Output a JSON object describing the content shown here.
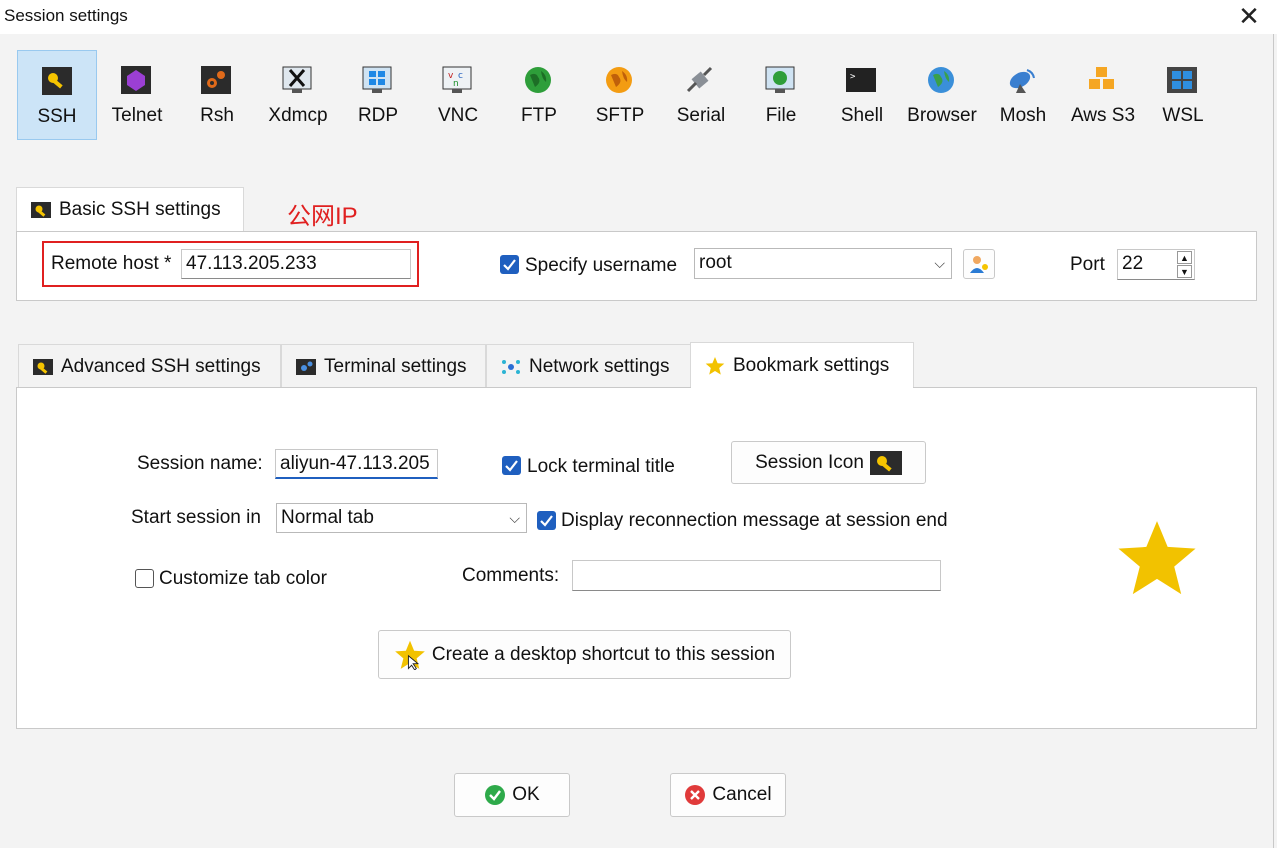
{
  "window": {
    "title": "Session settings"
  },
  "protocols": [
    {
      "label": "SSH",
      "icon": "ssh-key-icon",
      "selected": true
    },
    {
      "label": "Telnet",
      "icon": "telnet-icon"
    },
    {
      "label": "Rsh",
      "icon": "rsh-gear-icon"
    },
    {
      "label": "Xdmcp",
      "icon": "xdmcp-x-icon"
    },
    {
      "label": "RDP",
      "icon": "rdp-windows-icon"
    },
    {
      "label": "VNC",
      "icon": "vnc-icon"
    },
    {
      "label": "FTP",
      "icon": "ftp-globe-icon"
    },
    {
      "label": "SFTP",
      "icon": "sftp-globe-icon"
    },
    {
      "label": "Serial",
      "icon": "serial-plug-icon"
    },
    {
      "label": "File",
      "icon": "file-monitor-icon"
    },
    {
      "label": "Shell",
      "icon": "shell-terminal-icon"
    },
    {
      "label": "Browser",
      "icon": "browser-globe-icon"
    },
    {
      "label": "Mosh",
      "icon": "mosh-satellite-icon"
    },
    {
      "label": "Aws S3",
      "icon": "aws-cubes-icon"
    },
    {
      "label": "WSL",
      "icon": "wsl-windows-icon"
    }
  ],
  "basic": {
    "tab_label": "Basic SSH settings",
    "annotation": "公网IP",
    "remote_host_label": "Remote host *",
    "remote_host_value": "47.113.205.233",
    "specify_username_label": "Specify username",
    "specify_username_checked": true,
    "username_value": "root",
    "port_label": "Port",
    "port_value": "22"
  },
  "tabs": [
    {
      "label": "Advanced SSH settings",
      "icon": "key-icon"
    },
    {
      "label": "Terminal settings",
      "icon": "terminal-gear-icon"
    },
    {
      "label": "Network settings",
      "icon": "network-icon"
    },
    {
      "label": "Bookmark settings",
      "icon": "star-icon",
      "active": true
    }
  ],
  "bookmark": {
    "session_name_label": "Session name:",
    "session_name_value": "aliyun-47.113.205",
    "lock_title_label": "Lock terminal title",
    "lock_title_checked": true,
    "session_icon_button": "Session Icon",
    "start_in_label": "Start session in",
    "start_in_value": "Normal tab",
    "reconnect_label": "Display reconnection message at session end",
    "reconnect_checked": true,
    "customize_color_label": "Customize tab color",
    "customize_color_checked": false,
    "comments_label": "Comments:",
    "comments_value": "",
    "shortcut_button": "Create a desktop shortcut to this session"
  },
  "footer": {
    "ok_label": "OK",
    "cancel_label": "Cancel"
  },
  "colors": {
    "accent": "#1f5fbf",
    "annotation": "#e02020",
    "star": "#f2c200",
    "selected_bg": "#cce4f7"
  }
}
